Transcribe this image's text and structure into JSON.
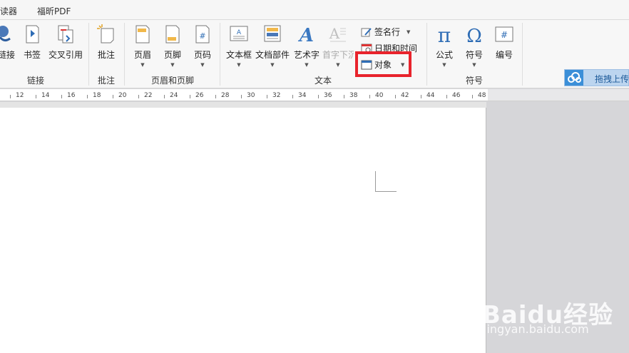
{
  "tabs": [
    "读器",
    "福昕PDF"
  ],
  "ribbon": {
    "groups": {
      "link": "链接",
      "comment": "批注",
      "header_footer": "页眉和页脚",
      "text": "文本",
      "symbol": "符号"
    },
    "buttons": {
      "hyperlink": "链接",
      "bookmark": "书签",
      "cross_ref": "交叉引用",
      "comment": "批注",
      "header": "页眉",
      "footer": "页脚",
      "page_number": "页码",
      "textbox": "文本框",
      "quick_parts": "文档部件",
      "wordart": "艺术字",
      "dropcap": "首字下沉",
      "signature": "签名行",
      "datetime": "日期和时间",
      "object": "对象",
      "equation": "公式",
      "symbol": "符号",
      "numbering": "编号"
    },
    "cloud_upload": "拖拽上传"
  },
  "ruler": {
    "labels": [
      "12",
      "14",
      "16",
      "18",
      "20",
      "22",
      "24",
      "26",
      "28",
      "30",
      "32",
      "34",
      "36",
      "38",
      "40",
      "42",
      "44",
      "46",
      "48"
    ]
  },
  "watermark": {
    "brand": "Baidu经验",
    "url": "jingyan.baidu.com"
  },
  "colors": {
    "highlight": "#e8232c",
    "accent": "#2f6db5"
  }
}
